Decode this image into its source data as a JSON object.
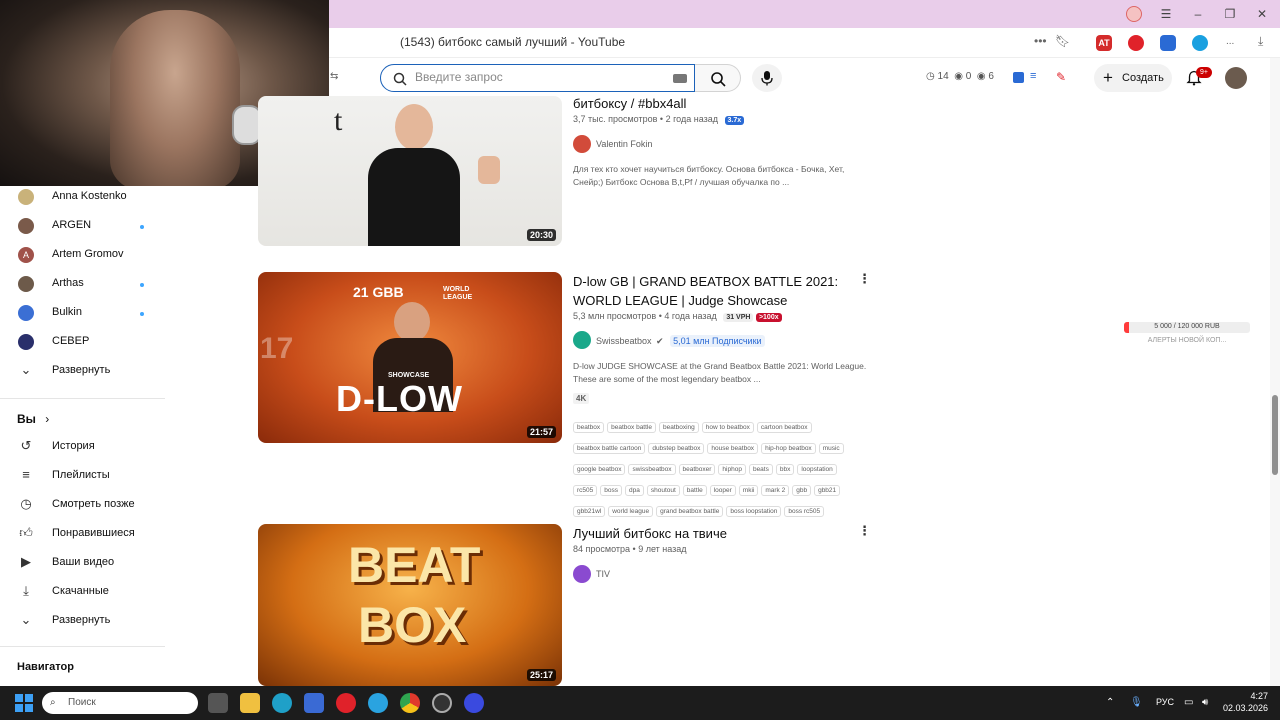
{
  "browser": {
    "tab_title": "(1543) битбокс самый лучший - YouTube",
    "ext_badge": "AT"
  },
  "header": {
    "search_placeholder": "Введите запрос",
    "stats": {
      "clock": "14",
      "eye_a": "0",
      "eye_b": "6"
    },
    "create_label": "Создать",
    "notifications_badge": "9+"
  },
  "sidebar": {
    "subscriptions": [
      {
        "name": "Anna Kostenko",
        "color": "#c9b27a",
        "dot": false
      },
      {
        "name": "ARGEN",
        "color": "#7a5a4a",
        "dot": true
      },
      {
        "name": "Artem Gromov",
        "color": "#a0524a",
        "dot": false,
        "letter": "A"
      },
      {
        "name": "Arthas",
        "color": "#6d5a4a",
        "dot": true
      },
      {
        "name": "Bulkin",
        "color": "#3b6fd4",
        "dot": true
      },
      {
        "name": "СЕВЕР",
        "color": "#2a2f6b",
        "dot": false
      }
    ],
    "expand_label": "Развернуть",
    "you_label": "Вы",
    "you_items": [
      {
        "label": "История",
        "icon": "history-icon"
      },
      {
        "label": "Плейлисты",
        "icon": "playlists-icon"
      },
      {
        "label": "Смотреть позже",
        "icon": "watch-later-icon"
      },
      {
        "label": "Понравившиеся",
        "icon": "like-icon"
      },
      {
        "label": "Ваши видео",
        "icon": "your-videos-icon"
      },
      {
        "label": "Скачанные",
        "icon": "download-icon"
      }
    ],
    "expand_label_2": "Развернуть",
    "navigator_label": "Навигатор"
  },
  "videos": [
    {
      "title": "битбоксу / #bbx4all",
      "views": "3,7 тыс. просмотров",
      "age": "2 года назад",
      "badge": "3.7x",
      "channel": "Valentin Fokin",
      "description": "Для тех кто хочет научиться битбоксу. Основа битбокса - Бочка, Хет, Снейр;) Битбокс Основа B,t,Pf / лучшая обучалка по ...",
      "duration": "20:30",
      "thumb_letter": "t"
    },
    {
      "title": "D-low GB | GRAND BEATBOX BATTLE 2021: WORLD LEAGUE | Judge Showcase",
      "views": "5,3 млн просмотров",
      "age": "4 года назад",
      "vph": "31 VPH",
      "multiplier": ">100x",
      "channel": "Swissbeatbox",
      "subscribers": "5,01 млн Подписчики",
      "description": "D-low JUDGE SHOWCASE at the Grand Beatbox Battle 2021: World League. These are some of the most legendary beatbox ...",
      "quality": "4K",
      "tags": [
        "beatbox",
        "beatbox battle",
        "beatboxing",
        "how to beatbox",
        "cartoon beatbox",
        "beatbox battle cartoon",
        "dubstep beatbox",
        "house beatbox",
        "hip-hop beatbox",
        "music",
        "google beatbox",
        "swissbeatbox",
        "beatboxer",
        "hiphop",
        "beats",
        "bbx",
        "loopstation",
        "rc505",
        "boss",
        "dpa",
        "shoutout",
        "battle",
        "looper",
        "mkii",
        "mark 2",
        "gbb",
        "gbb21",
        "gbb21wl",
        "world league",
        "grand beatbox battle",
        "boss loopstation",
        "boss rc505"
      ],
      "duration": "21:57",
      "thumb_text": "D-LOW",
      "thumb_header": "21 GBB",
      "thumb_sub": "WORLD LEAGUE",
      "thumb_showcase": "SHOWCASE",
      "thumb_num": "17"
    },
    {
      "title": "Лучший битбокс на твиче",
      "views": "84 просмотра",
      "age": "9 лет назад",
      "channel": "TIV",
      "duration": "25:17",
      "thumb_text_1": "BEAT",
      "thumb_text_2": "BOX"
    }
  ],
  "donate": {
    "text": "5 000 / 120 000 RUB",
    "progress": 0.04,
    "sub": "АЛЕРТЫ НОВОЙ КОП..."
  },
  "taskbar": {
    "search_label": "Поиск",
    "lang": "РУС",
    "time": "4:27",
    "date": "02.03.2026"
  }
}
